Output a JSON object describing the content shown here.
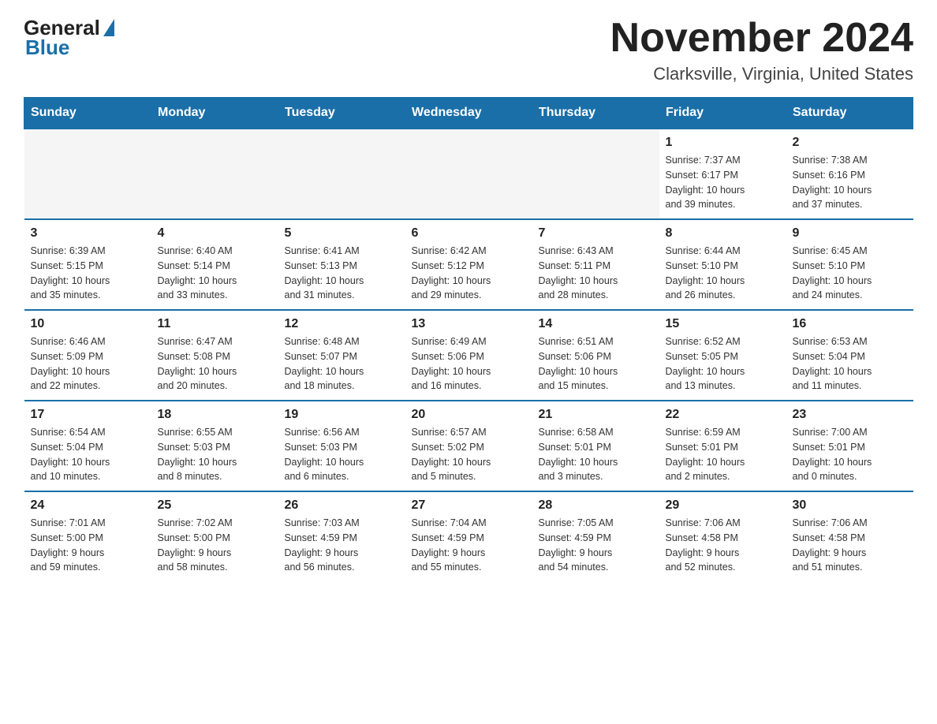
{
  "logo": {
    "general": "General",
    "blue": "Blue"
  },
  "title": "November 2024",
  "subtitle": "Clarksville, Virginia, United States",
  "days_of_week": [
    "Sunday",
    "Monday",
    "Tuesday",
    "Wednesday",
    "Thursday",
    "Friday",
    "Saturday"
  ],
  "weeks": [
    [
      {
        "day": "",
        "info": ""
      },
      {
        "day": "",
        "info": ""
      },
      {
        "day": "",
        "info": ""
      },
      {
        "day": "",
        "info": ""
      },
      {
        "day": "",
        "info": ""
      },
      {
        "day": "1",
        "info": "Sunrise: 7:37 AM\nSunset: 6:17 PM\nDaylight: 10 hours\nand 39 minutes."
      },
      {
        "day": "2",
        "info": "Sunrise: 7:38 AM\nSunset: 6:16 PM\nDaylight: 10 hours\nand 37 minutes."
      }
    ],
    [
      {
        "day": "3",
        "info": "Sunrise: 6:39 AM\nSunset: 5:15 PM\nDaylight: 10 hours\nand 35 minutes."
      },
      {
        "day": "4",
        "info": "Sunrise: 6:40 AM\nSunset: 5:14 PM\nDaylight: 10 hours\nand 33 minutes."
      },
      {
        "day": "5",
        "info": "Sunrise: 6:41 AM\nSunset: 5:13 PM\nDaylight: 10 hours\nand 31 minutes."
      },
      {
        "day": "6",
        "info": "Sunrise: 6:42 AM\nSunset: 5:12 PM\nDaylight: 10 hours\nand 29 minutes."
      },
      {
        "day": "7",
        "info": "Sunrise: 6:43 AM\nSunset: 5:11 PM\nDaylight: 10 hours\nand 28 minutes."
      },
      {
        "day": "8",
        "info": "Sunrise: 6:44 AM\nSunset: 5:10 PM\nDaylight: 10 hours\nand 26 minutes."
      },
      {
        "day": "9",
        "info": "Sunrise: 6:45 AM\nSunset: 5:10 PM\nDaylight: 10 hours\nand 24 minutes."
      }
    ],
    [
      {
        "day": "10",
        "info": "Sunrise: 6:46 AM\nSunset: 5:09 PM\nDaylight: 10 hours\nand 22 minutes."
      },
      {
        "day": "11",
        "info": "Sunrise: 6:47 AM\nSunset: 5:08 PM\nDaylight: 10 hours\nand 20 minutes."
      },
      {
        "day": "12",
        "info": "Sunrise: 6:48 AM\nSunset: 5:07 PM\nDaylight: 10 hours\nand 18 minutes."
      },
      {
        "day": "13",
        "info": "Sunrise: 6:49 AM\nSunset: 5:06 PM\nDaylight: 10 hours\nand 16 minutes."
      },
      {
        "day": "14",
        "info": "Sunrise: 6:51 AM\nSunset: 5:06 PM\nDaylight: 10 hours\nand 15 minutes."
      },
      {
        "day": "15",
        "info": "Sunrise: 6:52 AM\nSunset: 5:05 PM\nDaylight: 10 hours\nand 13 minutes."
      },
      {
        "day": "16",
        "info": "Sunrise: 6:53 AM\nSunset: 5:04 PM\nDaylight: 10 hours\nand 11 minutes."
      }
    ],
    [
      {
        "day": "17",
        "info": "Sunrise: 6:54 AM\nSunset: 5:04 PM\nDaylight: 10 hours\nand 10 minutes."
      },
      {
        "day": "18",
        "info": "Sunrise: 6:55 AM\nSunset: 5:03 PM\nDaylight: 10 hours\nand 8 minutes."
      },
      {
        "day": "19",
        "info": "Sunrise: 6:56 AM\nSunset: 5:03 PM\nDaylight: 10 hours\nand 6 minutes."
      },
      {
        "day": "20",
        "info": "Sunrise: 6:57 AM\nSunset: 5:02 PM\nDaylight: 10 hours\nand 5 minutes."
      },
      {
        "day": "21",
        "info": "Sunrise: 6:58 AM\nSunset: 5:01 PM\nDaylight: 10 hours\nand 3 minutes."
      },
      {
        "day": "22",
        "info": "Sunrise: 6:59 AM\nSunset: 5:01 PM\nDaylight: 10 hours\nand 2 minutes."
      },
      {
        "day": "23",
        "info": "Sunrise: 7:00 AM\nSunset: 5:01 PM\nDaylight: 10 hours\nand 0 minutes."
      }
    ],
    [
      {
        "day": "24",
        "info": "Sunrise: 7:01 AM\nSunset: 5:00 PM\nDaylight: 9 hours\nand 59 minutes."
      },
      {
        "day": "25",
        "info": "Sunrise: 7:02 AM\nSunset: 5:00 PM\nDaylight: 9 hours\nand 58 minutes."
      },
      {
        "day": "26",
        "info": "Sunrise: 7:03 AM\nSunset: 4:59 PM\nDaylight: 9 hours\nand 56 minutes."
      },
      {
        "day": "27",
        "info": "Sunrise: 7:04 AM\nSunset: 4:59 PM\nDaylight: 9 hours\nand 55 minutes."
      },
      {
        "day": "28",
        "info": "Sunrise: 7:05 AM\nSunset: 4:59 PM\nDaylight: 9 hours\nand 54 minutes."
      },
      {
        "day": "29",
        "info": "Sunrise: 7:06 AM\nSunset: 4:58 PM\nDaylight: 9 hours\nand 52 minutes."
      },
      {
        "day": "30",
        "info": "Sunrise: 7:06 AM\nSunset: 4:58 PM\nDaylight: 9 hours\nand 51 minutes."
      }
    ]
  ]
}
